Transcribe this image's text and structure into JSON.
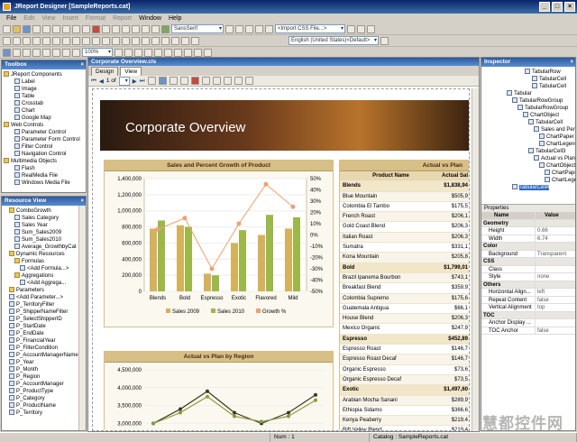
{
  "window": {
    "title": "JReport Designer [SampleReports.cat]"
  },
  "menu": [
    {
      "label": "File",
      "enabled": true
    },
    {
      "label": "Edit",
      "enabled": false
    },
    {
      "label": "View",
      "enabled": false
    },
    {
      "label": "Insert",
      "enabled": false
    },
    {
      "label": "Format",
      "enabled": false
    },
    {
      "label": "Report",
      "enabled": false
    },
    {
      "label": "Window",
      "enabled": true
    },
    {
      "label": "Help",
      "enabled": true
    }
  ],
  "toolbar": {
    "font_combo": "SansSerif",
    "css_combo": "<Import CSS File...>",
    "locale_combo": "English (United States)<Default>",
    "zoom_combo": "100%"
  },
  "toolbox": {
    "title": "Toolbox",
    "groups": [
      {
        "label": "JReport Components",
        "items": [
          "Label",
          "Image",
          "Table",
          "Crosstab",
          "Chart",
          "Google Map"
        ]
      },
      {
        "label": "Web Controls",
        "items": [
          "Parameter Control",
          "Parameter Form Control",
          "Filter Control",
          "Navigation Control"
        ]
      },
      {
        "label": "Multimedia Objects",
        "items": [
          "Flash",
          "RealMedia File",
          "Windows Media File"
        ]
      }
    ]
  },
  "resource_view": {
    "title": "Resource View",
    "items": [
      "ComboGrowth",
      "Sales Category",
      "Sales Year",
      "Sum_Sales2009",
      "Sum_Sales2010",
      "Average_GrowthbyCat",
      "Dynamic Resources",
      "Formulas",
      "<Add Formula...>",
      "Aggregations",
      "<Add Aggrega...",
      "Parameters",
      "<Add Parameter...>",
      "P_TerritoryFilter",
      "P_ShipperNameFilter",
      "P_SelectShipperID",
      "P_StartDate",
      "P_EndDate",
      "P_FinancialYear",
      "P_FilterCondition",
      "P_AccountManagerName",
      "P_Year",
      "P_Month",
      "P_Region",
      "P_AccountManager",
      "P_ProductType",
      "P_Category",
      "P_ProductName",
      "P_Territory"
    ]
  },
  "document": {
    "title": "Corporate Overview.cls",
    "tabs": [
      "Design",
      "View"
    ],
    "page_label": "1 of",
    "banner_title": "Corporate Overview",
    "chart_title": "Sales and Percent Growth of Product",
    "chart2_title": "Actual vs Plan by Region",
    "table_title": "Actual vs Plan",
    "table_headers": [
      "Product Name",
      "Actual Sal"
    ],
    "table_rows": [
      {
        "name": "Blends",
        "value": "$1,838,94",
        "group": true
      },
      {
        "name": "Blue Mountain",
        "value": "$505,9"
      },
      {
        "name": "Colombia El Tambo",
        "value": "$175,5"
      },
      {
        "name": "French Roast",
        "value": "$206,1"
      },
      {
        "name": "Gold Coast Blend",
        "value": "$206,3"
      },
      {
        "name": "Italian Roast",
        "value": "$206,3"
      },
      {
        "name": "Sumatra",
        "value": "$331,1"
      },
      {
        "name": "Kona Mountain",
        "value": "$205,8"
      },
      {
        "name": "Bold",
        "value": "$1,799,01",
        "group": true
      },
      {
        "name": "Brazil Ipanema Bourbon",
        "value": "$743,1"
      },
      {
        "name": "Breakfast Blend",
        "value": "$359,9"
      },
      {
        "name": "Colombia Supremo",
        "value": "$175,6"
      },
      {
        "name": "Guatemala Antigua",
        "value": "$66,1"
      },
      {
        "name": "House Blend",
        "value": "$206,3"
      },
      {
        "name": "Mexico Organic",
        "value": "$247,9"
      },
      {
        "name": "Espresso",
        "value": "$452,89",
        "group": true
      },
      {
        "name": "Espresso Roast",
        "value": "$146,7"
      },
      {
        "name": "Espresso Roast Decaf",
        "value": "$146,7"
      },
      {
        "name": "Organic Espresso",
        "value": "$73,6"
      },
      {
        "name": "Organic Espresso Decaf",
        "value": "$73,5"
      },
      {
        "name": "Exotic",
        "value": "$1,497,60",
        "group": true
      },
      {
        "name": "Arabian Mocha Sanani",
        "value": "$289,9"
      },
      {
        "name": "Ethiopia Sidamo",
        "value": "$366,6"
      },
      {
        "name": "Kenya Peaberry",
        "value": "$219,4"
      },
      {
        "name": "Rift Valley Blend",
        "value": "$219,4"
      }
    ]
  },
  "inspector": {
    "title": "Inspector",
    "tree": [
      "TabularRow",
      "TabularCell",
      "TabularCell",
      "Tabular",
      "TabularRowGroup",
      "TabularRowGroup",
      "ChartObject",
      "TabularCell",
      "Sales and Perce",
      "ChartPaper",
      "ChartLegend",
      "TabularCell3",
      "Actual vs Plan t",
      "ChartObject1",
      "ChartPaper",
      "ChartLegend",
      "TabularCell4"
    ],
    "props_title": "Properties",
    "props_headers": [
      "Name",
      "Value"
    ],
    "props": [
      {
        "k": "Geometry",
        "v": "",
        "cat": true
      },
      {
        "k": "Height",
        "v": "0.66"
      },
      {
        "k": "Width",
        "v": "6.74"
      },
      {
        "k": "Color",
        "v": "",
        "cat": true
      },
      {
        "k": "Background",
        "v": "Transparent"
      },
      {
        "k": "CSS",
        "v": "",
        "cat": true
      },
      {
        "k": "Class",
        "v": ""
      },
      {
        "k": "Style",
        "v": "none"
      },
      {
        "k": "Others",
        "v": "",
        "cat": true
      },
      {
        "k": "Horizontal Align...",
        "v": "left"
      },
      {
        "k": "Repeat Content",
        "v": "false"
      },
      {
        "k": "Vertical Alignment",
        "v": "top"
      },
      {
        "k": "TOC",
        "v": "",
        "cat": true
      },
      {
        "k": "Anchor Display ...",
        "v": ""
      },
      {
        "k": "TOC Anchor",
        "v": "false"
      }
    ]
  },
  "status": {
    "num": "Num : 1",
    "catalog": "Catalog : SampleReports.cat"
  },
  "watermark": "慧都控件网",
  "chart_data": [
    {
      "type": "bar",
      "title": "Sales and Percent Growth of Product",
      "categories": [
        "Blends",
        "Bold",
        "Espresso",
        "Exotic",
        "Flavored",
        "Mild"
      ],
      "series": [
        {
          "name": "Sales 2009",
          "values": [
            780000,
            820000,
            220000,
            600000,
            700000,
            780000
          ]
        },
        {
          "name": "Sales 2010",
          "values": [
            880000,
            800000,
            200000,
            760000,
            950000,
            920000
          ]
        },
        {
          "name": "Growth %",
          "values": [
            5,
            15,
            -30,
            10,
            45,
            25
          ]
        }
      ],
      "ylim": [
        0,
        1400000
      ],
      "y_ticks": [
        "1,400,000",
        "1,200,000",
        "1,000,000",
        "800,000",
        "600,000",
        "400,000",
        "200,000",
        "0"
      ],
      "y2lim": [
        -50,
        50
      ],
      "y2_ticks": [
        "50%",
        "40%",
        "30%",
        "20%",
        "10%",
        "0%",
        "-10%",
        "-20%",
        "-30%",
        "-40%",
        "-50%"
      ],
      "colors": {
        "Sales 2009": "#d4b25c",
        "Sales 2010": "#9cb84a",
        "Growth %": "#f0a070"
      },
      "legend": "bottom"
    },
    {
      "type": "line",
      "title": "Actual vs Plan by Region",
      "y_ticks": [
        "4,500,000",
        "4,000,000",
        "3,500,000",
        "3,000,000"
      ],
      "ylim": [
        3000000,
        4500000
      ],
      "series": [
        {
          "values": [
            3000000,
            3400000,
            3900000,
            3300000,
            3000000,
            3300000,
            3800000
          ]
        },
        {
          "values": [
            3000000,
            3300000,
            3750000,
            3200000,
            3050000,
            3200000,
            3650000
          ]
        }
      ]
    }
  ]
}
